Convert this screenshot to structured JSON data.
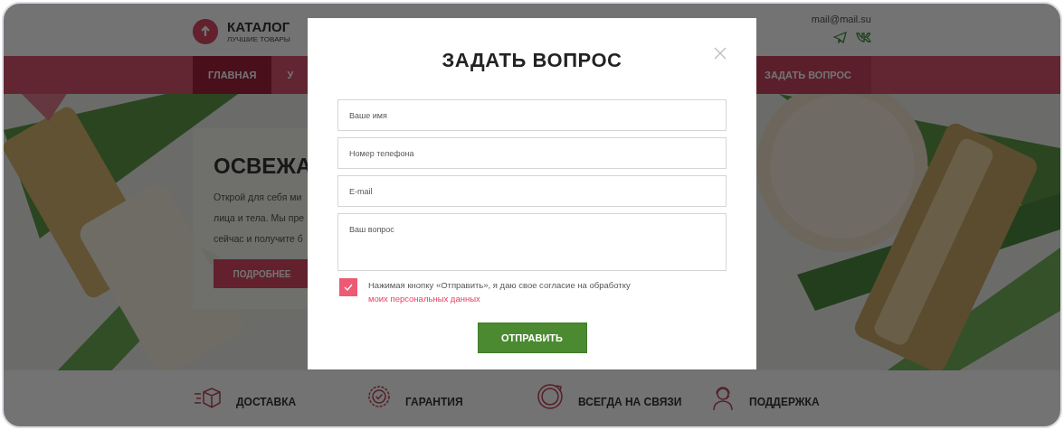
{
  "header": {
    "logo_title": "КАТАЛОГ",
    "logo_subtitle": "ЛУЧШИЕ ТОВАРЫ",
    "email": "mail@mail.su"
  },
  "nav": [
    {
      "label": "ГЛАВНАЯ",
      "selected": true,
      "kind": "link"
    },
    {
      "label": "У",
      "selected": false,
      "kind": "link"
    },
    {
      "label": "ЗАДАТЬ ВОПРОС",
      "selected": false,
      "kind": "cta"
    }
  ],
  "hero": {
    "title": "ОСВЕЖА",
    "lines": [
      "Открой для себя ми",
      "лица и тела. Мы пре",
      "сейчас и получите б"
    ],
    "button": "ПОДРОБНЕЕ"
  },
  "features": [
    {
      "label": "ДОСТАВКА",
      "kind": "delivery"
    },
    {
      "label": "ГАРАНТИЯ",
      "kind": "guarantee"
    },
    {
      "label": "ВСЕГДА НА СВЯЗИ",
      "kind": "always"
    },
    {
      "label": "ПОДДЕРЖКА",
      "kind": "support"
    }
  ],
  "modal": {
    "title": "ЗАДАТЬ ВОПРОС",
    "fields": [
      {
        "placeholder": "Ваше имя",
        "kind": "line"
      },
      {
        "placeholder": "Номер телефона",
        "kind": "line"
      },
      {
        "placeholder": "E-mail",
        "kind": "line"
      },
      {
        "placeholder": "Ваш вопрос",
        "kind": "area"
      }
    ],
    "consent": {
      "checked": true,
      "text": "Нажимая кнопку «Отправить», я даю свое согласие на обработку ",
      "link": "моих персональных данных"
    },
    "submit": "ОТПРАВИТЬ"
  }
}
